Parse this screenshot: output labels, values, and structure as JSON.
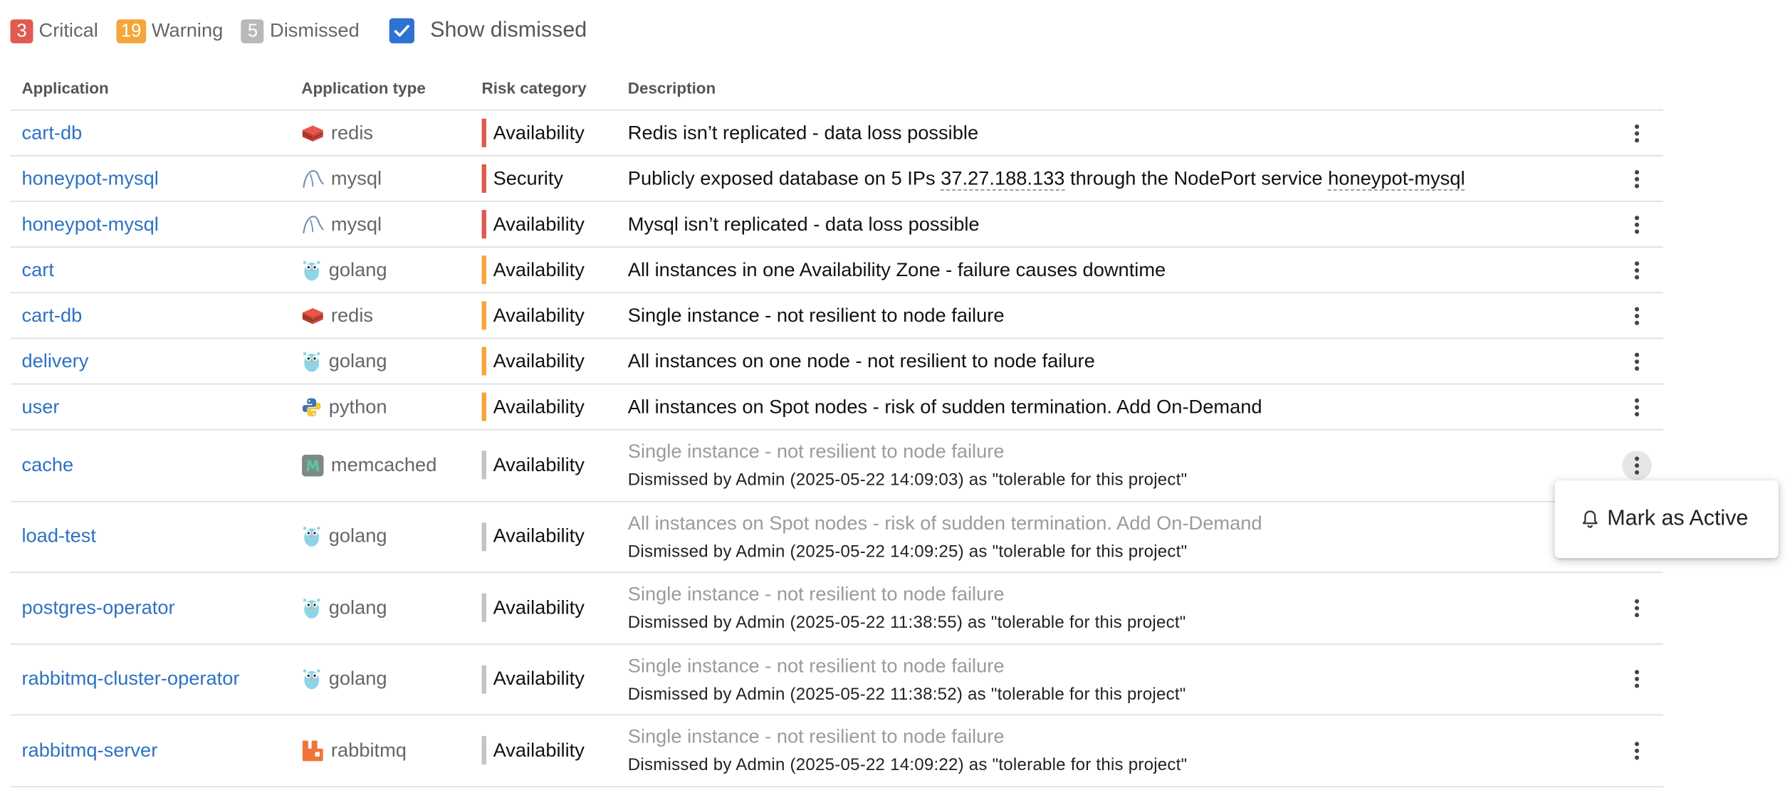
{
  "summary": {
    "critical": {
      "count": "3",
      "label": "Critical",
      "color": "#e05a50"
    },
    "warning": {
      "count": "19",
      "label": "Warning",
      "color": "#f5a63a"
    },
    "dismissed": {
      "count": "5",
      "label": "Dismissed",
      "color": "#b8b8b8"
    },
    "show_dismissed": {
      "label": "Show dismissed",
      "checked": true,
      "color": "#2e72d2"
    }
  },
  "table": {
    "headers": {
      "application": "Application",
      "type": "Application type",
      "risk": "Risk category",
      "description": "Description"
    },
    "rows": [
      {
        "app": "cart-db",
        "type": "redis",
        "icon": "redis-icon",
        "severity": "critical",
        "risk": "Availability",
        "desc": "Redis isn’t replicated - data loss possible"
      },
      {
        "app": "honeypot-mysql",
        "type": "mysql",
        "icon": "mysql-icon",
        "severity": "critical",
        "risk": "Security",
        "desc_parts": {
          "a": "Publicly exposed database on 5 IPs ",
          "ip": "37.27.188.133",
          "b": " through the NodePort service ",
          "svc": "honeypot-mysql"
        }
      },
      {
        "app": "honeypot-mysql",
        "type": "mysql",
        "icon": "mysql-icon",
        "severity": "critical",
        "risk": "Availability",
        "desc": "Mysql isn’t replicated - data loss possible"
      },
      {
        "app": "cart",
        "type": "golang",
        "icon": "golang-icon",
        "severity": "warning",
        "risk": "Availability",
        "desc": "All instances in one Availability Zone - failure causes downtime"
      },
      {
        "app": "cart-db",
        "type": "redis",
        "icon": "redis-icon",
        "severity": "warning",
        "risk": "Availability",
        "desc": "Single instance - not resilient to node failure"
      },
      {
        "app": "delivery",
        "type": "golang",
        "icon": "golang-icon",
        "severity": "warning",
        "risk": "Availability",
        "desc": "All instances on one node - not resilient to node failure"
      },
      {
        "app": "user",
        "type": "python",
        "icon": "python-icon",
        "severity": "warning",
        "risk": "Availability",
        "desc": "All instances on Spot nodes - risk of sudden termination. Add On-Demand"
      },
      {
        "app": "cache",
        "type": "memcached",
        "icon": "memcached-icon",
        "severity": "dismissed",
        "risk": "Availability",
        "desc": "Single instance - not resilient to node failure",
        "note": "Dismissed by Admin (2025-05-22 14:09:03) as \"tolerable for this project\""
      },
      {
        "app": "load-test",
        "type": "golang",
        "icon": "golang-icon",
        "severity": "dismissed",
        "risk": "Availability",
        "desc": "All instances on Spot nodes - risk of sudden termination. Add On-Demand",
        "note": "Dismissed by Admin (2025-05-22 14:09:25) as \"tolerable for this project\""
      },
      {
        "app": "postgres-operator",
        "type": "golang",
        "icon": "golang-icon",
        "severity": "dismissed",
        "risk": "Availability",
        "desc": "Single instance - not resilient to node failure",
        "note": "Dismissed by Admin (2025-05-22 11:38:55) as \"tolerable for this project\""
      },
      {
        "app": "rabbitmq-cluster-operator",
        "type": "golang",
        "icon": "golang-icon",
        "severity": "dismissed",
        "risk": "Availability",
        "desc": "Single instance - not resilient to node failure",
        "note": "Dismissed by Admin (2025-05-22 11:38:52) as \"tolerable for this project\""
      },
      {
        "app": "rabbitmq-server",
        "type": "rabbitmq",
        "icon": "rabbitmq-icon",
        "severity": "dismissed",
        "risk": "Availability",
        "desc": "Single instance - not resilient to node failure",
        "note": "Dismissed by Admin (2025-05-22 14:09:22) as \"tolerable for this project\""
      }
    ]
  },
  "popup": {
    "label": "Mark as Active",
    "icon": "bell-icon"
  },
  "colors": {
    "link": "#2e72c2",
    "critical": "#e05a50",
    "warning": "#f5a63a",
    "dismissed": "#c4c4c4"
  }
}
